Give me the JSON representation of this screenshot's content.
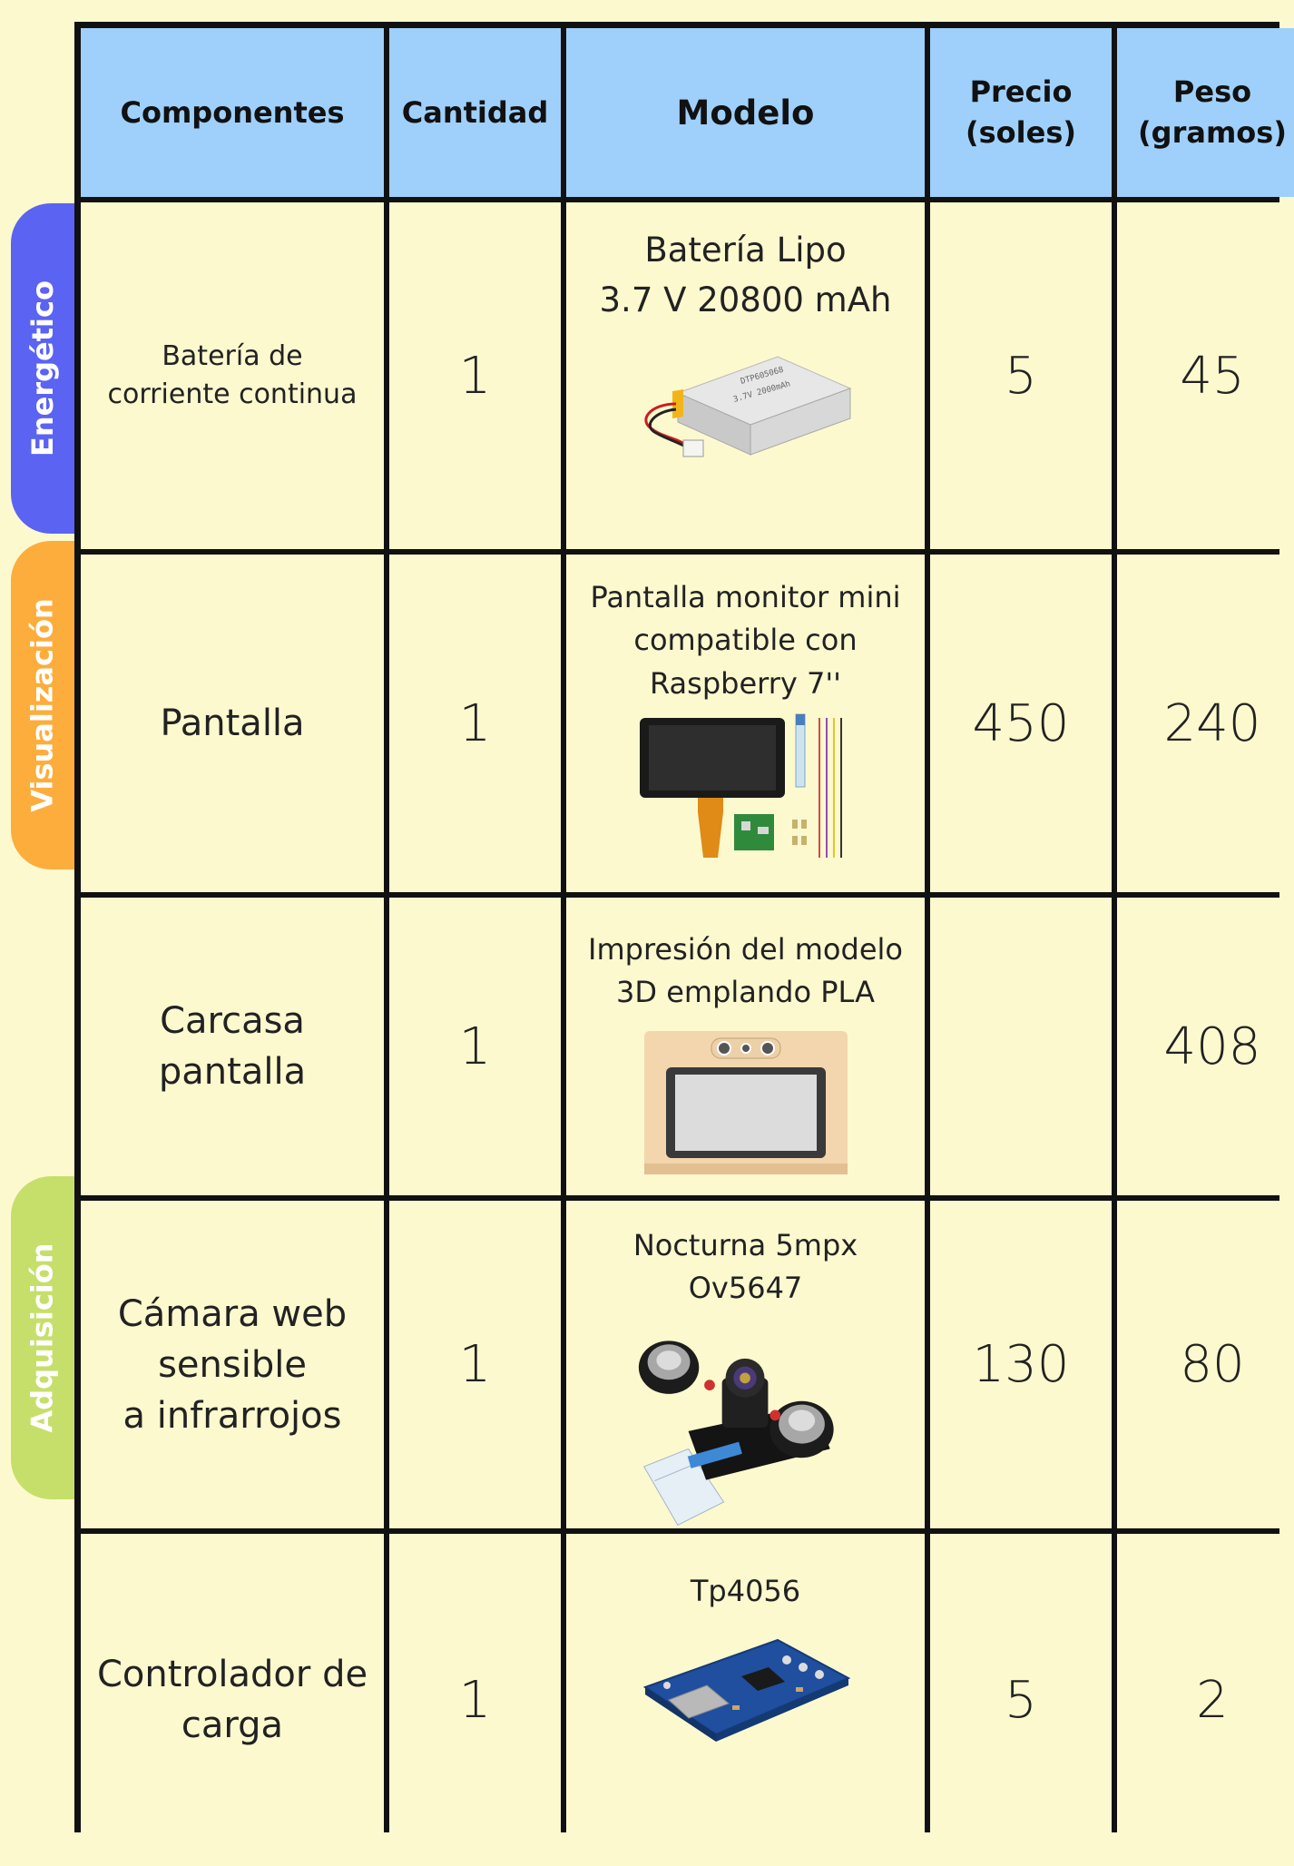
{
  "table": {
    "headers": {
      "componentes": "Componentes",
      "cantidad": "Cantidad",
      "modelo": "Modelo",
      "precio": "Precio\n(soles)",
      "peso": "Peso\n(gramos)"
    },
    "rows": [
      {
        "componente": "Batería de\ncorriente continua",
        "cantidad": "1",
        "modelo": "Batería Lipo\n3.7 V 20800 mAh",
        "precio": "5",
        "peso": "45"
      },
      {
        "componente": "Pantalla",
        "cantidad": "1",
        "modelo": "Pantalla monitor mini\ncompatible con\nRaspberry 7''",
        "precio": "450",
        "peso": "240"
      },
      {
        "componente": "Carcasa pantalla",
        "cantidad": "1",
        "modelo": "Impresión del modelo\n3D emplando PLA",
        "precio": "",
        "peso": "408"
      },
      {
        "componente": "Cámara web\nsensible\na infrarrojos",
        "cantidad": "1",
        "modelo": "Nocturna 5mpx Ov5647",
        "precio": "130",
        "peso": "80"
      },
      {
        "componente": "Controlador de\ncarga",
        "cantidad": "1",
        "modelo": "Tp4056",
        "precio": "5",
        "peso": "2"
      }
    ]
  },
  "categories": [
    {
      "label": "Energético",
      "color": "#5b63f2"
    },
    {
      "label": "Visualización",
      "color": "#fdad3c"
    },
    {
      "label": "Adquisición",
      "color": "#c6df6b"
    }
  ],
  "images": {
    "battery_label_line1": "DTP605068",
    "battery_label_line2": "3.7V 2000mAh"
  },
  "colors": {
    "header": "#9ed0fb",
    "background": "#fdf9cf",
    "grid": "#111111"
  }
}
